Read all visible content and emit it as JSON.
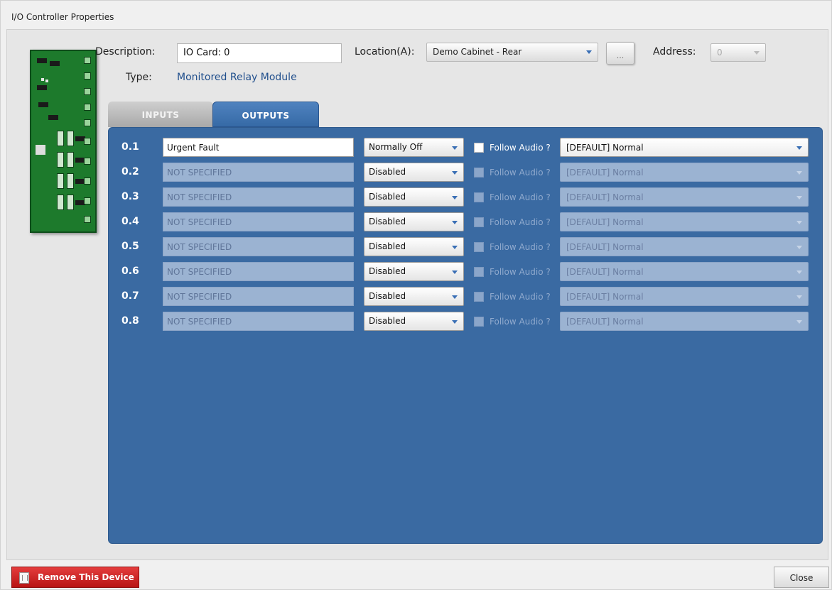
{
  "window": {
    "title": "I/O Controller Properties"
  },
  "form": {
    "description_label": "Description:",
    "description_value": "IO Card: 0",
    "location_label": "Location(A):",
    "location_value": "Demo Cabinet - Rear",
    "browse_label": "...",
    "address_label": "Address:",
    "address_value": "0",
    "type_label": "Type:",
    "type_value": "Monitored Relay Module"
  },
  "tabs": [
    {
      "label": "INPUTS",
      "active": false
    },
    {
      "label": "OUTPUTS",
      "active": true
    }
  ],
  "outputs": [
    {
      "num": "0.1",
      "name": "Urgent Fault",
      "mode": "Normally Off",
      "follow_audio": "Follow Audio ?",
      "audio": "[DEFAULT] Normal",
      "enabled": true
    },
    {
      "num": "0.2",
      "name": "NOT SPECIFIED",
      "mode": "Disabled",
      "follow_audio": "Follow Audio ?",
      "audio": "[DEFAULT] Normal",
      "enabled": false
    },
    {
      "num": "0.3",
      "name": "NOT SPECIFIED",
      "mode": "Disabled",
      "follow_audio": "Follow Audio ?",
      "audio": "[DEFAULT] Normal",
      "enabled": false
    },
    {
      "num": "0.4",
      "name": "NOT SPECIFIED",
      "mode": "Disabled",
      "follow_audio": "Follow Audio ?",
      "audio": "[DEFAULT] Normal",
      "enabled": false
    },
    {
      "num": "0.5",
      "name": "NOT SPECIFIED",
      "mode": "Disabled",
      "follow_audio": "Follow Audio ?",
      "audio": "[DEFAULT] Normal",
      "enabled": false
    },
    {
      "num": "0.6",
      "name": "NOT SPECIFIED",
      "mode": "Disabled",
      "follow_audio": "Follow Audio ?",
      "audio": "[DEFAULT] Normal",
      "enabled": false
    },
    {
      "num": "0.7",
      "name": "NOT SPECIFIED",
      "mode": "Disabled",
      "follow_audio": "Follow Audio ?",
      "audio": "[DEFAULT] Normal",
      "enabled": false
    },
    {
      "num": "0.8",
      "name": "NOT SPECIFIED",
      "mode": "Disabled",
      "follow_audio": "Follow Audio ?",
      "audio": "[DEFAULT] Normal",
      "enabled": false
    }
  ],
  "footer": {
    "remove_label": "Remove This Device",
    "close_label": "Close"
  },
  "colors": {
    "panel": "#3a6aa2",
    "remove": "#d22525",
    "accent": "#1f4e8c"
  },
  "icons": [
    "circuit-board-image",
    "trash-icon",
    "chevron-down-icon"
  ]
}
